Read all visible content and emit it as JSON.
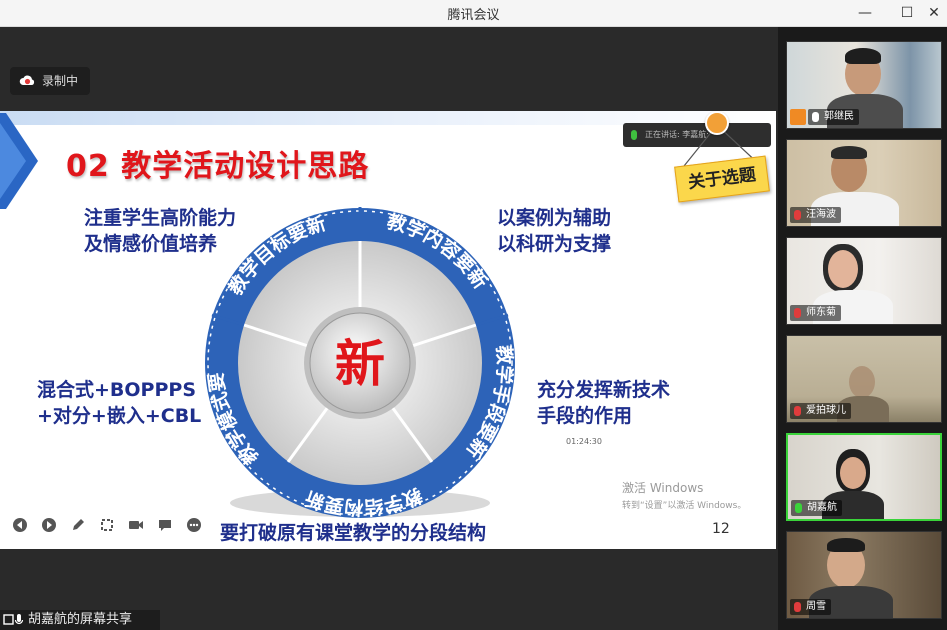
{
  "window": {
    "title": "腾讯会议",
    "minimize_glyph": "—",
    "maximize_glyph": "☐",
    "close_glyph": "✕"
  },
  "recording": {
    "label": "录制中",
    "icon": "record-cloud-icon"
  },
  "slide": {
    "title": "02 教学活动设计思路",
    "tag": "关于选题",
    "speaking": "正在讲话: 李嘉航;",
    "center": "新",
    "wheel_segments": [
      "教学目标要新",
      "教学内容要新",
      "教学手段要新",
      "教学结构要新",
      "教学模式要新"
    ],
    "notes": {
      "top_left": [
        "注重学生高阶能力",
        "及情感价值培养"
      ],
      "top_right": [
        "以案例为辅助",
        "以科研为支撑"
      ],
      "bottom_left": [
        "混合式+BOPPPS",
        "+对分+嵌入+CBL"
      ],
      "bottom_right": [
        "充分发挥新技术",
        "手段的作用"
      ]
    },
    "timestamp": "01:24:30",
    "bottom_line": "要打破原有课堂教学的分段结构",
    "page_number": "12",
    "watermark": {
      "line1": "激活 Windows",
      "line2": "转到“设置”以激活 Windows。"
    },
    "colors": {
      "title": "#e0161b",
      "notes": "#1f2f8c",
      "ring": "#2d63b8"
    }
  },
  "toolbar": {
    "tools": [
      "prev-icon",
      "next-icon",
      "pen-icon",
      "crop-icon",
      "camera-icon",
      "comment-icon",
      "more-icon"
    ]
  },
  "share": {
    "label": "胡嘉航的屏幕共享"
  },
  "participants": [
    {
      "name": "郭继民",
      "host": true,
      "mic": "on",
      "active": false
    },
    {
      "name": "汪海波",
      "host": false,
      "mic": "muted",
      "active": false
    },
    {
      "name": "师东菊",
      "host": false,
      "mic": "muted",
      "active": false
    },
    {
      "name": "爱拍球儿",
      "host": false,
      "mic": "muted",
      "active": false
    },
    {
      "name": "胡嘉航",
      "host": false,
      "mic": "on",
      "active": true
    },
    {
      "name": "周雪",
      "host": false,
      "mic": "muted",
      "active": false
    }
  ]
}
